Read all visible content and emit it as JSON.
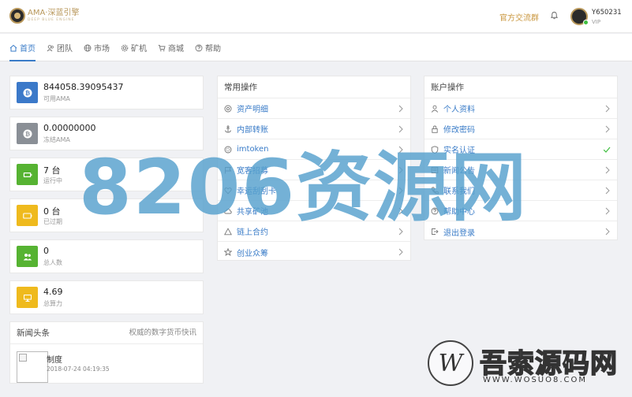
{
  "header": {
    "logo_title": "AMA·深蓝引擎",
    "logo_sub": "DEEP BLUE ENGINE",
    "group_link": "官方交流群",
    "user_name": "Y650231",
    "user_level": "VIP"
  },
  "nav": {
    "items": [
      {
        "label": "首页",
        "icon": "home-icon"
      },
      {
        "label": "团队",
        "icon": "team-icon"
      },
      {
        "label": "市场",
        "icon": "globe-icon"
      },
      {
        "label": "矿机",
        "icon": "gear-icon"
      },
      {
        "label": "商城",
        "icon": "cart-icon"
      },
      {
        "label": "帮助",
        "icon": "help-icon"
      }
    ]
  },
  "stats": [
    {
      "value": "844058.39095437",
      "label": "可用AMA",
      "color": "#3b79c9",
      "icon": "bitcoin-icon"
    },
    {
      "value": "0.00000000",
      "label": "冻结AMA",
      "color": "#8a8f96",
      "icon": "bitcoin-icon"
    },
    {
      "value": "7 台",
      "label": "运行中",
      "color": "#56b332",
      "icon": "battery-full-icon"
    },
    {
      "value": "0 台",
      "label": "已过期",
      "color": "#efba1d",
      "icon": "battery-empty-icon"
    },
    {
      "value": "0",
      "label": "总人数",
      "color": "#56b332",
      "icon": "users-icon"
    },
    {
      "value": "4.69",
      "label": "总算力",
      "color": "#efba1d",
      "icon": "monitor-icon"
    }
  ],
  "common": {
    "title": "常用操作",
    "items": [
      {
        "label": "资产明细",
        "icon": "asset-icon"
      },
      {
        "label": "内部转账",
        "icon": "anchor-icon"
      },
      {
        "label": "imtoken",
        "icon": "wallet-icon"
      },
      {
        "label": "宽客招募",
        "icon": "flag-icon"
      },
      {
        "label": "幸运刮刮卡",
        "icon": "heart-icon"
      },
      {
        "label": "共享矿池",
        "icon": "cloud-icon"
      },
      {
        "label": "链上合约",
        "icon": "triangle-icon"
      },
      {
        "label": "创业众筹",
        "icon": "star-icon"
      }
    ]
  },
  "account": {
    "title": "账户操作",
    "items": [
      {
        "label": "个人资料",
        "icon": "user-icon"
      },
      {
        "label": "修改密码",
        "icon": "lock-icon"
      },
      {
        "label": "实名认证",
        "icon": "shield-icon"
      },
      {
        "label": "新闻公告",
        "icon": "news-icon"
      },
      {
        "label": "联系我们",
        "icon": "phone-icon"
      },
      {
        "label": "帮助中心",
        "icon": "help-icon"
      },
      {
        "label": "退出登录",
        "icon": "logout-icon"
      }
    ]
  },
  "news": {
    "title": "新闻头条",
    "subtitle": "权威的数字货币快讯",
    "item_title": "制度",
    "item_date": "2018-07-24 04:19:35"
  },
  "watermarks": {
    "main": "8206资源网",
    "brand": "吾索源码网",
    "url": "WWW.WOSUO8.COM",
    "brand_letter": "W"
  },
  "colors": {
    "accent": "#3a7cc8",
    "gold": "#c9963d",
    "success": "#3fbf3f"
  }
}
